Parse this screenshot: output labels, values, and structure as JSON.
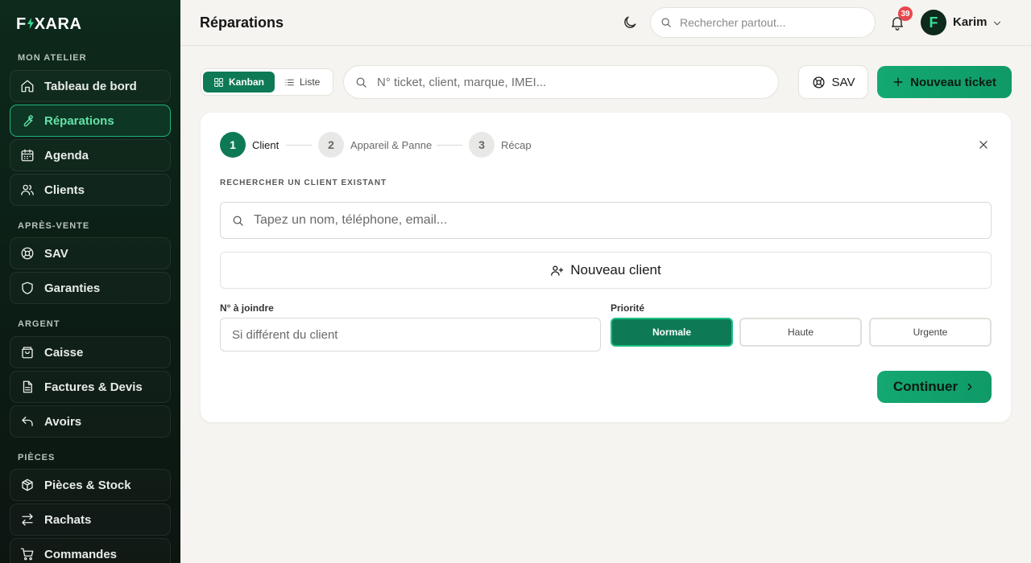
{
  "app": {
    "logo_left": "F",
    "logo_right": "XARA"
  },
  "sidebar": {
    "sections": [
      {
        "label": "MON ATELIER"
      },
      {
        "label": "APRÈS-VENTE"
      },
      {
        "label": "ARGENT"
      },
      {
        "label": "PIÈCES"
      }
    ],
    "items": [
      {
        "label": "Tableau de bord",
        "icon": "home-icon"
      },
      {
        "label": "Réparations",
        "icon": "wrench-icon",
        "active": true
      },
      {
        "label": "Agenda",
        "icon": "calendar-icon"
      },
      {
        "label": "Clients",
        "icon": "users-icon"
      },
      {
        "label": "SAV",
        "icon": "lifebuoy-icon"
      },
      {
        "label": "Garanties",
        "icon": "shield-icon"
      },
      {
        "label": "Caisse",
        "icon": "register-icon"
      },
      {
        "label": "Factures & Devis",
        "icon": "document-icon"
      },
      {
        "label": "Avoirs",
        "icon": "undo-icon"
      },
      {
        "label": "Pièces & Stock",
        "icon": "package-icon"
      },
      {
        "label": "Rachats",
        "icon": "swap-icon"
      },
      {
        "label": "Commandes",
        "icon": "cart-icon"
      }
    ]
  },
  "header": {
    "title": "Réparations",
    "search_placeholder": "Rechercher partout...",
    "notification_count": "39",
    "user_initial": "F",
    "user_name": "Karim"
  },
  "toolbar": {
    "view_kanban": "Kanban",
    "view_liste": "Liste",
    "active_view": "Kanban",
    "search_placeholder": "N° ticket, client, marque, IMEI...",
    "sav_label": "SAV",
    "new_ticket_label": "Nouveau ticket"
  },
  "wizard": {
    "steps": [
      {
        "number": "1",
        "label": "Client",
        "active": true
      },
      {
        "number": "2",
        "label": "Appareil & Panne",
        "active": false
      },
      {
        "number": "3",
        "label": "Récap",
        "active": false
      }
    ],
    "search_section_label": "RECHERCHER UN CLIENT EXISTANT",
    "client_search_placeholder": "Tapez un nom, téléphone, email...",
    "new_client_label": "Nouveau client",
    "phone_label": "N° à joindre",
    "phone_placeholder": "Si différent du client",
    "priority_label": "Priorité",
    "priorities": [
      "Normale",
      "Haute",
      "Urgente"
    ],
    "selected_priority": "Normale",
    "continue_label": "Continuer"
  },
  "colors": {
    "accent": "#0e7a55",
    "accent_bright": "#14a872",
    "sidebar_bg": "#0d2a1c",
    "badge": "#e5484d"
  }
}
